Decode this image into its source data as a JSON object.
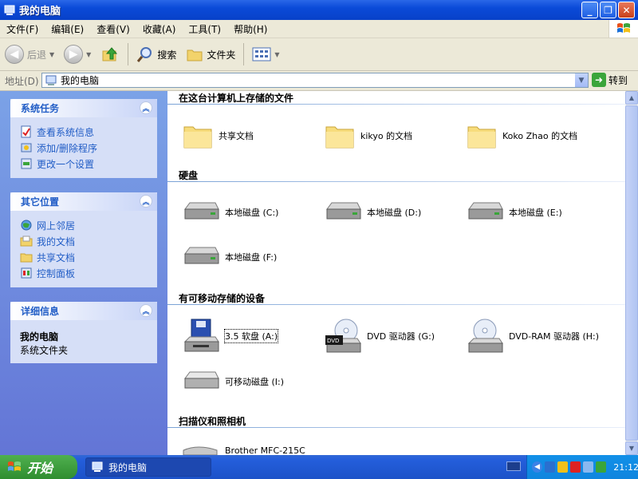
{
  "window": {
    "title": "我的电脑"
  },
  "menu": [
    "文件(F)",
    "编辑(E)",
    "查看(V)",
    "收藏(A)",
    "工具(T)",
    "帮助(H)"
  ],
  "toolbar": {
    "back": "后退",
    "search": "搜索",
    "folders": "文件夹"
  },
  "address": {
    "label": "地址(D)",
    "value": "我的电脑",
    "go": "转到"
  },
  "left": {
    "system_tasks": {
      "title": "系统任务",
      "links": [
        "查看系统信息",
        "添加/删除程序",
        "更改一个设置"
      ]
    },
    "other_places": {
      "title": "其它位置",
      "links": [
        "网上邻居",
        "我的文档",
        "共享文档",
        "控制面板"
      ]
    },
    "details": {
      "title": "详细信息",
      "name": "我的电脑",
      "sub": "系统文件夹"
    }
  },
  "sections": {
    "files": {
      "title": "在这台计算机上存储的文件",
      "items": [
        "共享文档",
        "kikyo 的文档",
        "Koko Zhao 的文档"
      ]
    },
    "hard_disks": {
      "title": "硬盘",
      "items": [
        "本地磁盘 (C:)",
        "本地磁盘 (D:)",
        "本地磁盘 (E:)",
        "本地磁盘 (F:)"
      ]
    },
    "removable": {
      "title": "有可移动存储的设备",
      "items": [
        "3.5 软盘 (A:)",
        "DVD 驱动器 (G:)",
        "DVD-RAM 驱动器 (H:)",
        "可移动磁盘 (I:)"
      ]
    },
    "scanners": {
      "title": "扫描仪和照相机",
      "items": [
        "Brother MFC-215C"
      ]
    }
  },
  "taskbar": {
    "start": "开始",
    "task": "我的电脑",
    "clock": "21:12"
  },
  "colors": {
    "title_blue": "#0a4ad8",
    "link_blue": "#215dc6",
    "start_green": "#2f8d2f"
  }
}
